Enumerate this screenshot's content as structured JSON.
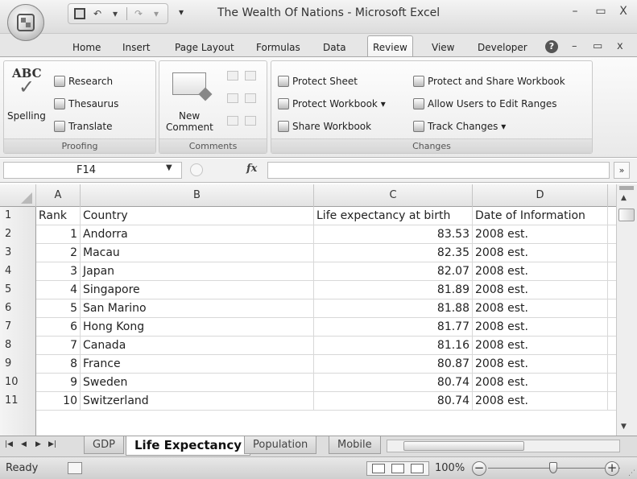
{
  "window": {
    "title": "The Wealth Of Nations - Microsoft Excel",
    "minimize": "–",
    "restore": "▭",
    "close": "X"
  },
  "qat": {
    "undo": "↶",
    "redo": "↷",
    "dropdown": "▾"
  },
  "tabs": [
    "Home",
    "Insert",
    "Page Layout",
    "Formulas",
    "Data",
    "Review",
    "View",
    "Developer"
  ],
  "active_tab": "Review",
  "ribbon": {
    "proofing": {
      "label": "Proofing",
      "spelling": "Spelling",
      "abc": "ABC",
      "research": "Research",
      "thesaurus": "Thesaurus",
      "translate": "Translate"
    },
    "comments": {
      "label": "Comments",
      "new_comment_line1": "New",
      "new_comment_line2": "Comment"
    },
    "changes": {
      "label": "Changes",
      "protect_sheet": "Protect Sheet",
      "protect_workbook": "Protect Workbook ▾",
      "share_workbook": "Share Workbook",
      "protect_share": "Protect and Share Workbook",
      "allow_users": "Allow Users to Edit Ranges",
      "track_changes": "Track Changes ▾"
    }
  },
  "formula_bar": {
    "name_box": "F14",
    "fx": "fx",
    "formula": "",
    "expand": "»"
  },
  "columns": [
    "A",
    "B",
    "C",
    "D"
  ],
  "rows": [
    {
      "num": "1",
      "a": "Rank",
      "b": "Country",
      "c": "Life expectancy at birth",
      "d": "Date of Information"
    },
    {
      "num": "2",
      "a": "1",
      "b": "Andorra",
      "c": "83.53",
      "d": "2008 est."
    },
    {
      "num": "3",
      "a": "2",
      "b": "Macau",
      "c": "82.35",
      "d": "2008 est."
    },
    {
      "num": "4",
      "a": "3",
      "b": "Japan",
      "c": "82.07",
      "d": "2008 est."
    },
    {
      "num": "5",
      "a": "4",
      "b": "Singapore",
      "c": "81.89",
      "d": "2008 est."
    },
    {
      "num": "6",
      "a": "5",
      "b": "San Marino",
      "c": "81.88",
      "d": "2008 est."
    },
    {
      "num": "7",
      "a": "6",
      "b": "Hong Kong",
      "c": "81.77",
      "d": "2008 est."
    },
    {
      "num": "8",
      "a": "7",
      "b": "Canada",
      "c": "81.16",
      "d": "2008 est."
    },
    {
      "num": "9",
      "a": "8",
      "b": "France",
      "c": "80.87",
      "d": "2008 est."
    },
    {
      "num": "10",
      "a": "9",
      "b": "Sweden",
      "c": "80.74",
      "d": "2008 est."
    },
    {
      "num": "11",
      "a": "10",
      "b": "Switzerland",
      "c": "80.74",
      "d": "2008 est."
    }
  ],
  "sheets": [
    "GDP",
    "Life Expectancy",
    "Population",
    "Mobile"
  ],
  "active_sheet": "Life Expectancy",
  "status": {
    "text": "Ready",
    "zoom": "100%"
  }
}
